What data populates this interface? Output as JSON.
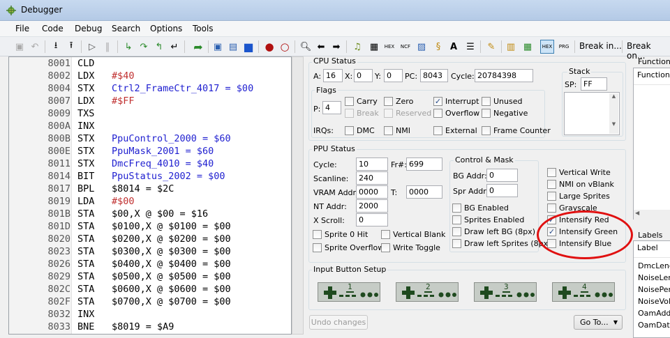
{
  "window": {
    "title": "Debugger"
  },
  "menu": [
    "File",
    "Code",
    "Debug",
    "Search",
    "Options",
    "Tools"
  ],
  "toolbar": {
    "break_in": "Break in...",
    "break_on": "Break on..."
  },
  "code_lines": [
    {
      "addr": "8001",
      "op": "CLD",
      "arg": ""
    },
    {
      "addr": "8002",
      "op": "LDX",
      "arg": "#$40"
    },
    {
      "addr": "8004",
      "op": "STX",
      "arg": "Ctrl2_FrameCtr_4017 = $00"
    },
    {
      "addr": "8007",
      "op": "LDX",
      "arg": "#$FF"
    },
    {
      "addr": "8009",
      "op": "TXS",
      "arg": ""
    },
    {
      "addr": "800A",
      "op": "INX",
      "arg": ""
    },
    {
      "addr": "800B",
      "op": "STX",
      "arg": "PpuControl_2000 = $60"
    },
    {
      "addr": "800E",
      "op": "STX",
      "arg": "PpuMask_2001 = $60"
    },
    {
      "addr": "8011",
      "op": "STX",
      "arg": "DmcFreq_4010 = $40"
    },
    {
      "addr": "8014",
      "op": "BIT",
      "arg": "PpuStatus_2002 = $00"
    },
    {
      "addr": "8017",
      "op": "BPL",
      "arg": "$8014 = $2C"
    },
    {
      "addr": "8019",
      "op": "LDA",
      "arg": "#$00"
    },
    {
      "addr": "801B",
      "op": "STA",
      "arg": "$00,X @ $00 = $16"
    },
    {
      "addr": "801D",
      "op": "STA",
      "arg": "$0100,X @ $0100 = $00"
    },
    {
      "addr": "8020",
      "op": "STA",
      "arg": "$0200,X @ $0200 = $00"
    },
    {
      "addr": "8023",
      "op": "STA",
      "arg": "$0300,X @ $0300 = $00"
    },
    {
      "addr": "8026",
      "op": "STA",
      "arg": "$0400,X @ $0400 = $00"
    },
    {
      "addr": "8029",
      "op": "STA",
      "arg": "$0500,X @ $0500 = $00"
    },
    {
      "addr": "802C",
      "op": "STA",
      "arg": "$0600,X @ $0600 = $00"
    },
    {
      "addr": "802F",
      "op": "STA",
      "arg": "$0700,X @ $0700 = $00"
    },
    {
      "addr": "8032",
      "op": "INX",
      "arg": ""
    },
    {
      "addr": "8033",
      "op": "BNE",
      "arg": "$8019 = $A9"
    }
  ],
  "cpu": {
    "title": "CPU Status",
    "a_label": "A:",
    "a": "16",
    "x_label": "X:",
    "x": "0",
    "y_label": "Y:",
    "y": "0",
    "pc_label": "PC:",
    "pc": "8043",
    "cycle_label": "Cycle:",
    "cycle": "20784398",
    "stack_title": "Stack",
    "sp_label": "SP:",
    "sp": "FF",
    "flags_title": "Flags",
    "p_label": "P:",
    "p": "4",
    "flags": {
      "carry": "Carry",
      "zero": "Zero",
      "interrupt": "Interrupt",
      "unused": "Unused",
      "break": "Break",
      "reserved": "Reserved",
      "overflow": "Overflow",
      "negative": "Negative"
    },
    "irqs_label": "IRQs:",
    "irqs": {
      "dmc": "DMC",
      "nmi": "NMI",
      "external": "External",
      "frame_counter": "Frame Counter"
    }
  },
  "ppu": {
    "title": "PPU Status",
    "cycle_label": "Cycle:",
    "cycle": "10",
    "fr_label": "Fr#:",
    "fr": "699",
    "scanline_label": "Scanline:",
    "scanline": "240",
    "vram_label": "VRAM Addr:",
    "vram": "0000",
    "t_label": "T:",
    "t": "0000",
    "nt_label": "NT Addr:",
    "nt": "2000",
    "xscroll_label": "X Scroll:",
    "xscroll": "0",
    "sprite0": "Sprite 0 Hit",
    "vblank": "Vertical Blank",
    "overflow": "Sprite Overflow",
    "write_toggle": "Write Toggle",
    "cm_title": "Control & Mask",
    "bg_addr_label": "BG Addr:",
    "bg_addr": "0",
    "spr_addr_label": "Spr Addr:",
    "spr_addr": "0",
    "bg_enabled": "BG Enabled",
    "sprites_enabled": "Sprites Enabled",
    "draw_left_bg": "Draw left BG (8px)",
    "draw_left_sprites": "Draw left Sprites (8px)",
    "vertical_write": "Vertical Write",
    "nmi_vblank": "NMI on vBlank",
    "large_sprites": "Large Sprites",
    "grayscale": "Grayscale",
    "intensify_red": "Intensify Red",
    "intensify_green": "Intensify Green",
    "intensify_blue": "Intensify Blue"
  },
  "input": {
    "title": "Input Button Setup",
    "pads": [
      "1",
      "2",
      "3",
      "4"
    ]
  },
  "buttons": {
    "undo": "Undo changes",
    "goto": "Go To..."
  },
  "functions": {
    "title": "Functions",
    "header": "Function"
  },
  "labels": {
    "title": "Labels",
    "header": "Label",
    "items": [
      "DmcLeng",
      "NoiseLen",
      "NoisePeri",
      "NoiseVolu",
      "OamAddr",
      "OamData"
    ]
  },
  "colors": {
    "accent": "#3c7fb1",
    "highlight_circle": "#e01010",
    "code_symbol": "#1f1fd0",
    "code_immediate": "#c03030"
  }
}
